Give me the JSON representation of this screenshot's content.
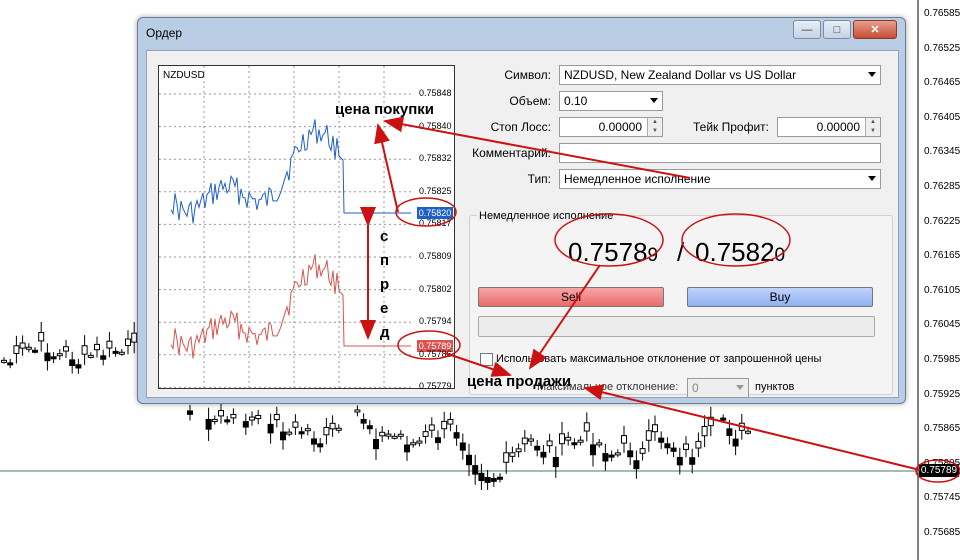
{
  "window": {
    "title": "Ордер",
    "controls": [
      "minimize-icon",
      "maximize-icon",
      "close-icon"
    ]
  },
  "mini_chart": {
    "symbol": "NZDUSD",
    "ticks": [
      "0.75848",
      "0.75840",
      "0.75832",
      "0.75825",
      "0.75817",
      "0.75809",
      "0.75802",
      "0.75794",
      "0.75786",
      "0.75779"
    ],
    "ask_price": "0.75820",
    "bid_price": "0.75789",
    "ask_color": "#1f5fc7",
    "bid_color": "#d9534f"
  },
  "form": {
    "symbol_label": "Символ:",
    "symbol_value": "NZDUSD, New Zealand Dollar vs US Dollar",
    "volume_label": "Объем:",
    "volume_value": "0.10",
    "stoploss_label": "Стоп Лосс:",
    "stoploss_value": "0.00000",
    "takeprofit_label": "Тейк Профит:",
    "takeprofit_value": "0.00000",
    "comment_label": "Комментарий:",
    "comment_value": "",
    "type_label": "Тип:",
    "type_value": "Немедленное исполнение"
  },
  "execution": {
    "group_title": "Немедленное исполнение",
    "bid_main": "0.7578",
    "bid_pip": "9",
    "ask_main": "0.7582",
    "ask_pip": "0",
    "slash": "/",
    "sell_label": "Sell",
    "buy_label": "Buy",
    "max_deviation_checkbox": "Использовать максимальное отклонение от запрошенной цены",
    "max_deviation_label": "Максимальное отклонение:",
    "max_deviation_value": "0",
    "points_label": "пунктов"
  },
  "annotations": {
    "ask_label": "цена покупки",
    "bid_label": "цена продажи",
    "spread_letters": [
      "с",
      "п",
      "р",
      "е",
      "д"
    ],
    "arrow_color": "#cc1111"
  },
  "background_chart": {
    "axis_labels": [
      "0.76585",
      "0.76525",
      "0.76465",
      "0.76405",
      "0.76345",
      "0.76285",
      "0.76225",
      "0.76165",
      "0.76105",
      "0.76045",
      "0.75985",
      "0.75925",
      "0.75865",
      "0.75805",
      "0.75745",
      "0.75685"
    ],
    "current_price": "0.75789"
  }
}
